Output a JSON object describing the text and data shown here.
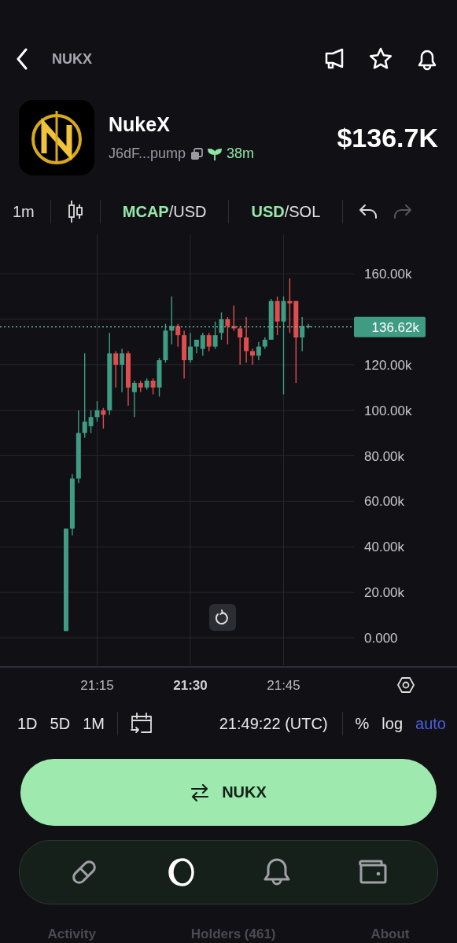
{
  "header": {
    "title": "NUKX"
  },
  "token": {
    "name": "NukeX",
    "address": "J6dF...pump",
    "age": "38m",
    "market_cap": "$136.7K"
  },
  "toolbar": {
    "interval": "1m",
    "pairs": [
      {
        "highlight": "MCAP",
        "rest": "/USD"
      },
      {
        "highlight": "USD",
        "rest": "/SOL"
      }
    ],
    "undo": {
      "disabled": false
    },
    "redo": {
      "disabled": true
    }
  },
  "chart": {
    "time_axis": [
      {
        "label": "21:15",
        "bold": false
      },
      {
        "label": "21:30",
        "bold": true
      },
      {
        "label": "21:45",
        "bold": false
      }
    ],
    "chart_data": {
      "type": "candlestick",
      "grid": true,
      "ylim": [
        -12.1,
        177.3
      ],
      "ref_lines": [
        {
          "axis": "y",
          "value": 136.62,
          "label": "136.62k"
        }
      ],
      "ohlc": [
        [
          3,
          48,
          3,
          48
        ],
        [
          48,
          72,
          45,
          70
        ],
        [
          70,
          100,
          68,
          90
        ],
        [
          90,
          125,
          88,
          95
        ],
        [
          93,
          100,
          90,
          97
        ],
        [
          97,
          104,
          95,
          100
        ],
        [
          100,
          101,
          92,
          98
        ],
        [
          100,
          134,
          98,
          125
        ],
        [
          125,
          126,
          110,
          120
        ],
        [
          120,
          127,
          108,
          125
        ],
        [
          125,
          126,
          102,
          110
        ],
        [
          108,
          113,
          97,
          112
        ],
        [
          112,
          113,
          108,
          110
        ],
        [
          110,
          114,
          109,
          113
        ],
        [
          113,
          114,
          107,
          110
        ],
        [
          110,
          123,
          106,
          122
        ],
        [
          122,
          138,
          121,
          135
        ],
        [
          135,
          150,
          129,
          137
        ],
        [
          137,
          138,
          128,
          133
        ],
        [
          133,
          135,
          114,
          122
        ],
        [
          122,
          134,
          121,
          128
        ],
        [
          128,
          131,
          125,
          131
        ],
        [
          127,
          134,
          124,
          133
        ],
        [
          133,
          134,
          126,
          128
        ],
        [
          128,
          139,
          127,
          133
        ],
        [
          134,
          143,
          131,
          140
        ],
        [
          140,
          141,
          129,
          137
        ],
        [
          137,
          146,
          135,
          136
        ],
        [
          136,
          137,
          120,
          132
        ],
        [
          132,
          141,
          121,
          126
        ],
        [
          126,
          127,
          120,
          124
        ],
        [
          124,
          130,
          122,
          128
        ],
        [
          128,
          132,
          127,
          131
        ],
        [
          131,
          149,
          131,
          148
        ],
        [
          148,
          150,
          133,
          139
        ],
        [
          139,
          150,
          107,
          148
        ],
        [
          148,
          158,
          134,
          147
        ],
        [
          148,
          148,
          112,
          132
        ],
        [
          132,
          141,
          126,
          137
        ],
        [
          137,
          138,
          136,
          137
        ]
      ],
      "yticks": [
        {
          "value": 160,
          "label": "160.00k"
        },
        {
          "value": 120,
          "label": "120.00k"
        },
        {
          "value": 100,
          "label": "100.00k"
        },
        {
          "value": 80,
          "label": "80.00k"
        },
        {
          "value": 60,
          "label": "60.00k"
        },
        {
          "value": 40,
          "label": "40.00k"
        },
        {
          "value": 20,
          "label": "20.00k"
        },
        {
          "value": 0,
          "label": "0.000"
        }
      ]
    }
  },
  "range_bar": {
    "ranges": [
      "1D",
      "5D",
      "1M"
    ],
    "time": "21:49:22 (UTC)",
    "options": [
      {
        "label": "%",
        "selected": false
      },
      {
        "label": "log",
        "selected": false
      },
      {
        "label": "auto",
        "selected": true
      }
    ]
  },
  "trade_button": {
    "label": "NUKX"
  },
  "nav": [
    {
      "kind": "pill",
      "selected": false
    },
    {
      "kind": "coin",
      "selected": true
    },
    {
      "kind": "bell",
      "selected": false
    },
    {
      "kind": "wallet",
      "selected": false
    }
  ],
  "tabs": [
    "Activity",
    "Holders (461)",
    "About"
  ]
}
